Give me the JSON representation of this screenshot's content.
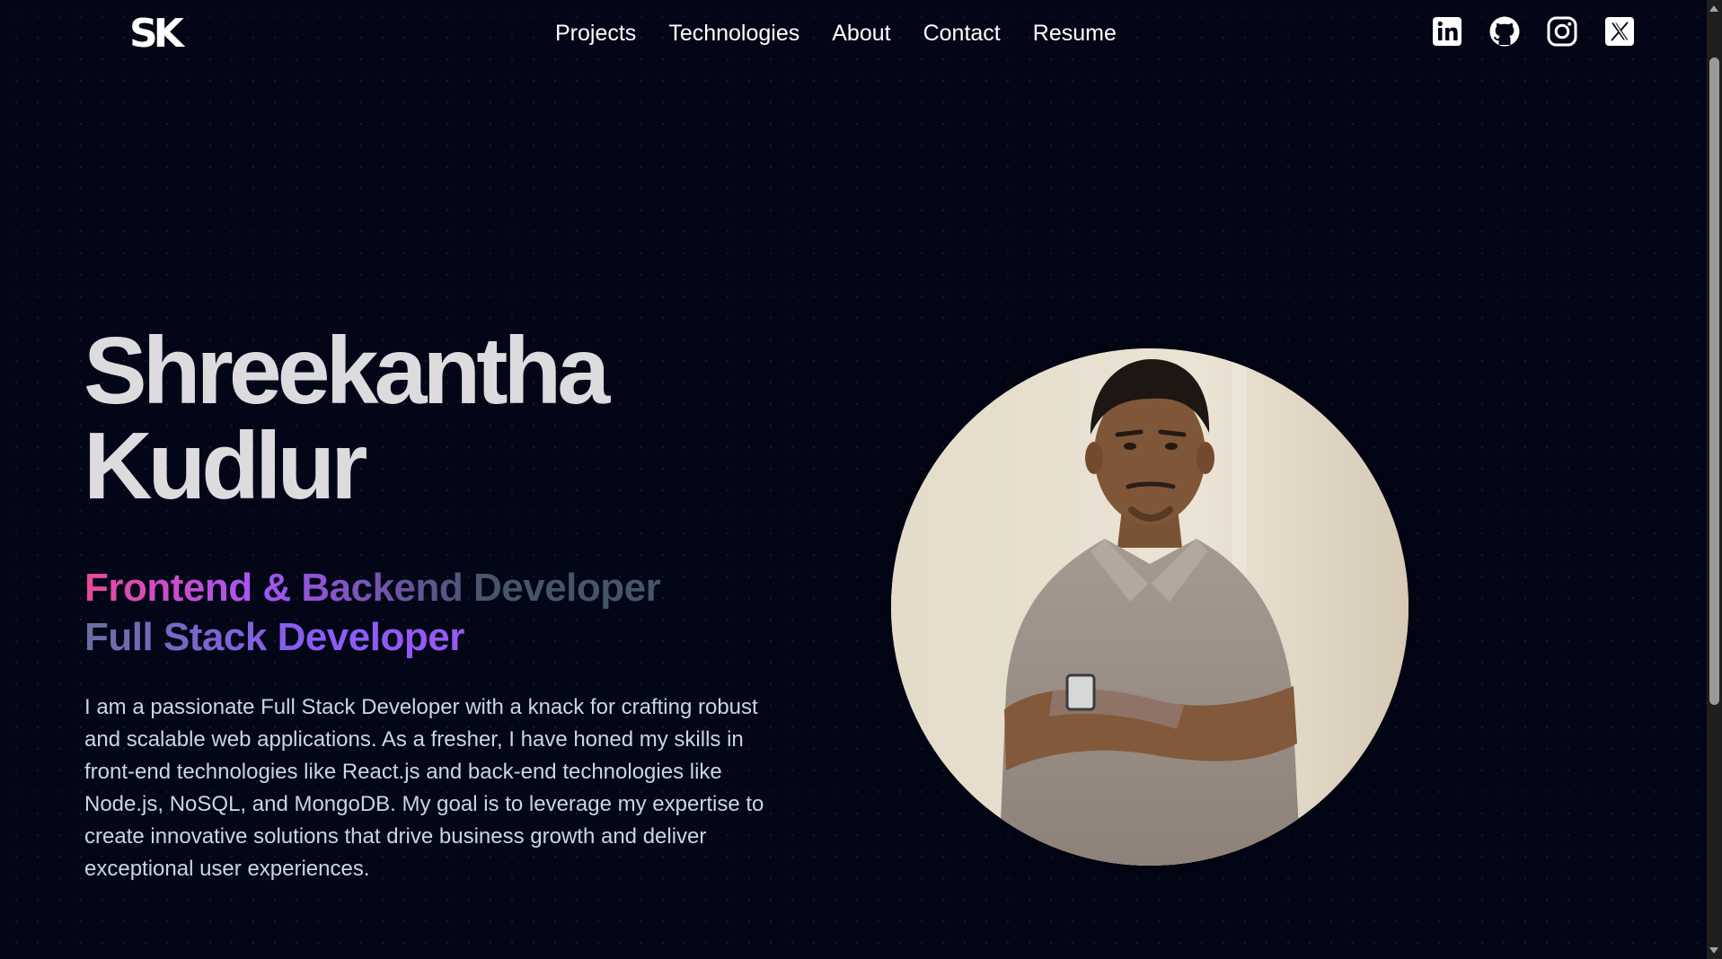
{
  "header": {
    "logo_text": "SK",
    "nav": [
      {
        "label": "Projects"
      },
      {
        "label": "Technologies"
      },
      {
        "label": "About"
      },
      {
        "label": "Contact"
      },
      {
        "label": "Resume"
      }
    ],
    "social": [
      {
        "icon": "linkedin-icon"
      },
      {
        "icon": "github-icon"
      },
      {
        "icon": "instagram-icon"
      },
      {
        "icon": "x-icon"
      }
    ]
  },
  "hero": {
    "first_name": "Shreekantha",
    "last_name": "Kudlur",
    "roles": [
      "Frontend & Backend Developer",
      "Full Stack Developer"
    ],
    "bio": "I am a passionate Full Stack Developer with a knack for crafting robust and scalable web applications. As a fresher, I have honed my skills in front-end technologies like React.js and back-end technologies like Node.js, NoSQL, and MongoDB. My goal is to leverage my expertise to create innovative solutions that drive business growth and deliver exceptional user experiences."
  },
  "colors": {
    "background": "#020617",
    "heading": "#dcdcdf",
    "body_text": "#cbd5e1",
    "gradient_pink": "#ec4899",
    "gradient_purple": "#a855f7",
    "gradient_slate": "#475569"
  }
}
